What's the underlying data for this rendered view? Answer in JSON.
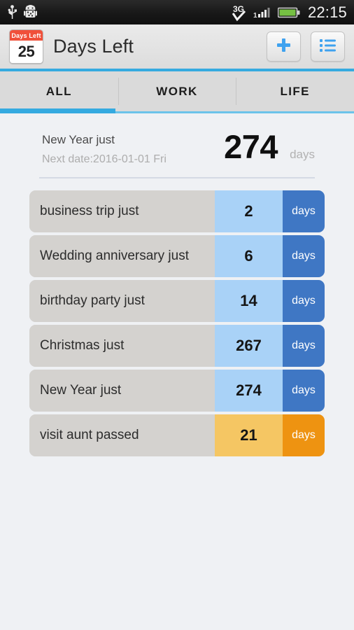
{
  "status_bar": {
    "time": "22:15",
    "left_icons": [
      "usb-icon",
      "android-debug-icon"
    ],
    "right_icons": [
      "3g-icon",
      "signal-icon",
      "battery-icon"
    ],
    "network_label": "3G"
  },
  "app_bar": {
    "icon": {
      "name": "days-left-calendar-icon",
      "top_label": "Days Left",
      "day_number": "25"
    },
    "title": "Days Left",
    "add_button_label": "+",
    "list_button_label": "list-icon",
    "accent_color": "#35aae0"
  },
  "tabs": {
    "items": [
      {
        "label": "ALL"
      },
      {
        "label": "WORK"
      },
      {
        "label": "LIFE"
      }
    ],
    "active_index": 0
  },
  "featured": {
    "title": "New Year just",
    "subtitle": "Next date:2016-01-01 Fri",
    "days": "274",
    "unit": "days"
  },
  "list": {
    "rows": [
      {
        "label": "business trip just",
        "days": "2",
        "unit": "days",
        "state": "future"
      },
      {
        "label": "Wedding anniversary just",
        "days": "6",
        "unit": "days",
        "state": "future"
      },
      {
        "label": "birthday party just",
        "days": "14",
        "unit": "days",
        "state": "future"
      },
      {
        "label": "Christmas just",
        "days": "267",
        "unit": "days",
        "state": "future"
      },
      {
        "label": "New Year just",
        "days": "274",
        "unit": "days",
        "state": "future"
      },
      {
        "label": "visit aunt passed",
        "days": "21",
        "unit": "days",
        "state": "past"
      }
    ]
  },
  "colors": {
    "page_background": "#eff1f4",
    "row_label_bg": "#d4d2cf",
    "future_number_bg": "#a9d2f7",
    "future_unit_bg": "#3f77c4",
    "past_number_bg": "#f5c663",
    "past_unit_bg": "#ee9311",
    "accent": "#35aae0"
  }
}
